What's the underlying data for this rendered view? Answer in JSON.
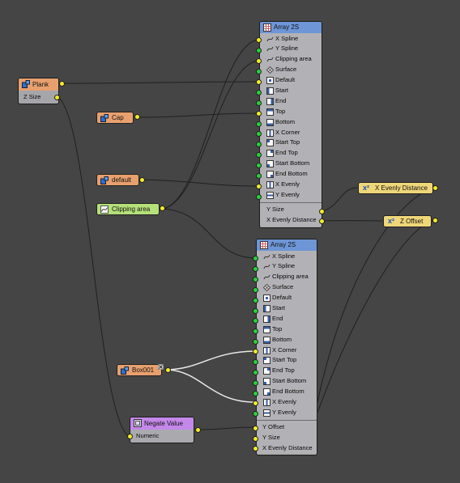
{
  "nodes": {
    "array_top": {
      "title": "Array 2S",
      "inputs": [
        "X Spline",
        "Y Spline",
        "Clipping area",
        "Surface",
        "Default",
        "Start",
        "End",
        "Top",
        "Bottom",
        "X Corner",
        "Start Top",
        "End Top",
        "Start Bottom",
        "End Bottom",
        "X Evenly",
        "Y Evenly"
      ],
      "outputs": [
        "Y Size",
        "X Evenly Distance"
      ]
    },
    "array_bottom": {
      "title": "Array 2S",
      "inputs": [
        "X Spline",
        "Y Spline",
        "Clipping area",
        "Surface",
        "Default",
        "Start",
        "End",
        "Top",
        "Bottom",
        "X Corner",
        "Start Top",
        "End Top",
        "Start Bottom",
        "End Bottom",
        "X Evenly",
        "Y Evenly"
      ],
      "outputs": [
        "Y Offset",
        "Y Size",
        "X Evenly Distance"
      ]
    },
    "plank": {
      "title": "Plank",
      "output": "Z Size"
    },
    "cap": {
      "title": "Cap"
    },
    "default": {
      "title": "default"
    },
    "clipping_area": {
      "title": "Clipping area"
    },
    "box001": {
      "title": "Box001"
    },
    "negate": {
      "title": "Negate Value",
      "input": "Numeric"
    },
    "x_evenly_distance": {
      "title": "X Evenly Distance"
    },
    "z_offset": {
      "title": "Z Offset"
    }
  },
  "icons": {
    "array": "grid-icon",
    "object": "object-icon",
    "spline": "spline-icon",
    "math": "x-squared-icon"
  },
  "colors": {
    "background": "#454545",
    "array_header": "#6e96d6",
    "object_node": "#e8a06e",
    "negate_header": "#c488ea",
    "math_node": "#efd679",
    "spline_node": "#b5e07a",
    "port_green": "#27d23a",
    "port_yellow": "#f2ec2a",
    "wire": "#202020",
    "wire_highlight": "#e8e8e8"
  }
}
